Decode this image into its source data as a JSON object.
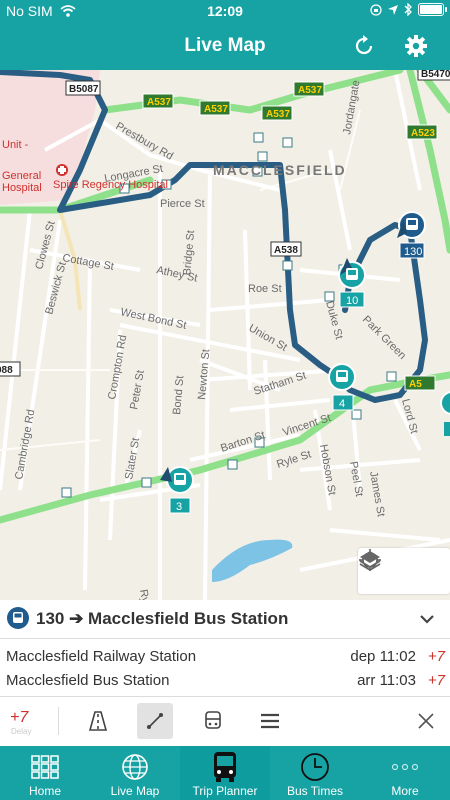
{
  "status": {
    "carrier": "No SIM",
    "time": "12:09"
  },
  "header": {
    "title": "Live Map",
    "refresh_icon": "refresh-icon",
    "settings_icon": "gear-icon"
  },
  "map": {
    "town_label": "MACCLESFIELD",
    "roads": {
      "a537": "A537",
      "a538": "A538",
      "a523": "A523",
      "b5087": "B5087",
      "b5470": "B5470",
      "a5x": "A5",
      "prestbury": "Prestbury Rd",
      "longacre": "Longacre St",
      "pierce": "Pierce St",
      "cottage": "Cottage St",
      "athey": "Athey St",
      "roe": "Roe St",
      "west_bond": "West Bond St",
      "union": "Union St",
      "statham": "Statham St",
      "barton": "Barton St",
      "vincent": "Vincent St",
      "ryle": "Ryle St",
      "peel": "Peel St",
      "james": "James St",
      "hobson": "Hobson St",
      "lord": "Lord St",
      "park_green": "Park Green",
      "duke": "Duke St",
      "bridge": "Bridge St",
      "newton": "Newton St",
      "bond": "Bond St",
      "peter": "Peter St",
      "crompton": "Crompton Rd",
      "slater": "Slater St",
      "cambridge": "Cambridge Rd",
      "clowes": "Clowes St",
      "beswick": "Beswick St",
      "jordangate": "Jordangate",
      "ryles_park": "Ryle's Park Rd",
      "a088": "088",
      "hospital": "Spire Regency Hospital",
      "unit": "Unit -",
      "general": "General",
      "hospital2": "Hospital"
    },
    "bus_markers": [
      {
        "label": "130"
      },
      {
        "label": "10"
      },
      {
        "label": "4"
      },
      {
        "label": "3"
      }
    ],
    "tools": {
      "locate_icon": "crosshair-icon",
      "layers_icon": "layers-icon"
    }
  },
  "route_panel": {
    "route_number": "130",
    "destination": "130 ➔ Macclesfield Bus Station",
    "stops": [
      {
        "name": "Macclesfield Railway Station",
        "time": "dep 11:02",
        "delay": "+7"
      },
      {
        "name": "Macclesfield Bus Station",
        "time": "arr 11:03",
        "delay": "+7"
      }
    ],
    "delay_badge": "+7",
    "delay_sub": "Delay"
  },
  "tabs": [
    {
      "label": "Home",
      "icon": "grid-icon"
    },
    {
      "label": "Live Map",
      "icon": "live-map-icon"
    },
    {
      "label": "Trip Planner",
      "icon": "bus-front-icon"
    },
    {
      "label": "Bus Times",
      "icon": "clock-icon"
    },
    {
      "label": "More",
      "icon": "more-icon"
    }
  ],
  "colors": {
    "teal": "#17a2a4",
    "route": "#2a5d84",
    "delay": "#d0312d",
    "green_road": "#8fe08a"
  }
}
